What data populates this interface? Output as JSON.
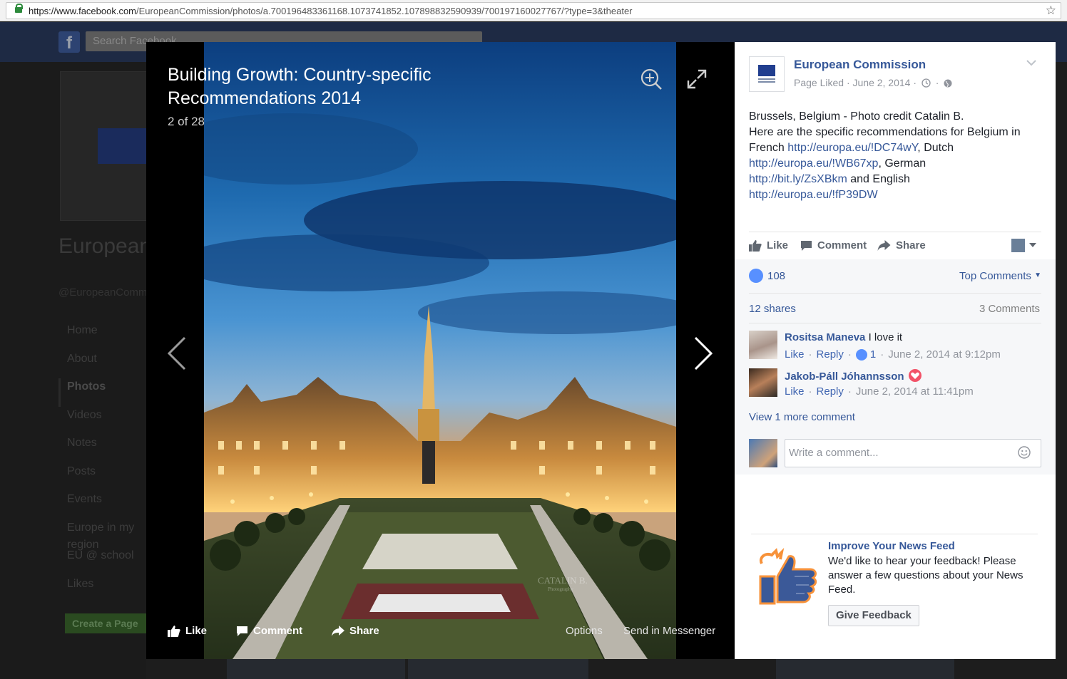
{
  "browser": {
    "url_prefix": "https://www.facebook.com",
    "url_path": "/EuropeanCommission/photos/a.700196483361168.1073741852.107898832590939/700197160027767/?type=3&theater"
  },
  "background": {
    "search_placeholder": "Search Facebook",
    "page_name": "European Commission",
    "page_handle": "@EuropeanCommission",
    "cover_caption": "European Commission",
    "nav": [
      "Home",
      "About",
      "Photos",
      "Videos",
      "Notes",
      "Posts",
      "Events",
      "Europe in my region",
      "EU @ school",
      "Likes"
    ],
    "create_page": "Create a Page"
  },
  "photo": {
    "title": "Building Growth: Country-specific Recommendations 2014",
    "counter": "2 of 28",
    "watermark": "CATALIN B.",
    "watermark_sub": "Photography",
    "actions": {
      "like": "Like",
      "comment": "Comment",
      "share": "Share",
      "options": "Options",
      "send": "Send in Messenger"
    }
  },
  "post": {
    "page_name": "European Commission",
    "meta": "Page Liked · June 2, 2014 ·",
    "text_lines": {
      "l1": "Brussels, Belgium - Photo credit Catalin B.",
      "l2": "Here are the specific recommendations for Belgium in French ",
      "link1": "http://europa.eu/!DC74wY",
      "t_dutch": ", Dutch ",
      "link2": "http://europa.eu/!WB67xp",
      "t_german": ", German ",
      "link3": "http://bit.ly/ZsXBkm",
      "t_english": " and English ",
      "link4": "http://europa.eu/!fP39DW"
    },
    "actions": {
      "like": "Like",
      "comment": "Comment",
      "share": "Share"
    },
    "likes_count": "108",
    "sort": "Top Comments",
    "shares": "12 shares",
    "comments_count": "3 Comments",
    "comments": [
      {
        "name": "Rositsa Maneva",
        "text": "I love it",
        "like": "Like",
        "reply": "Reply",
        "reactions": "1",
        "time": "June 2, 2014 at 9:12pm"
      },
      {
        "name": "Jakob-Páll Jóhannsson",
        "text": "",
        "like": "Like",
        "reply": "Reply",
        "time": "June 2, 2014 at 11:41pm"
      }
    ],
    "view_more": "View 1 more comment",
    "comment_placeholder": "Write a comment..."
  },
  "feedback": {
    "title": "Improve Your News Feed",
    "text": "We'd like to hear your feedback! Please answer a few questions about your News Feed.",
    "button": "Give Feedback"
  },
  "colors": {
    "link": "#365899",
    "fb_blue": "#4267b2",
    "like_blue": "#5890ff"
  }
}
